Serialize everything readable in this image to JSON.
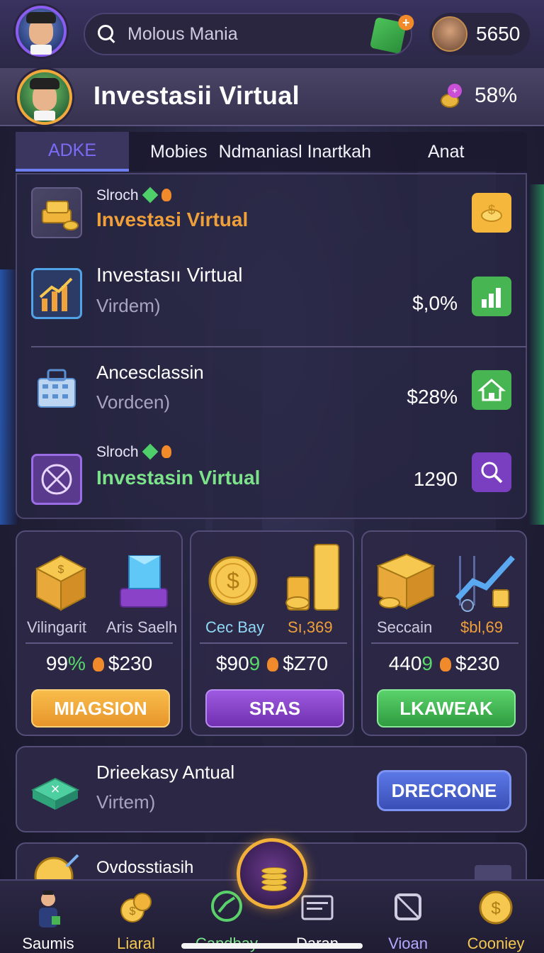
{
  "topbar": {
    "search_text": "Molous Mania",
    "coins": "5650"
  },
  "header": {
    "title": "Investasii Virtual",
    "percent": "58%"
  },
  "tabs": [
    "ADKE",
    "Mobies",
    "Ndmaniasl Inartkah",
    "Anat"
  ],
  "list": [
    {
      "top": "Slroch",
      "title": "Investasi Virtual",
      "sub": "",
      "value": "",
      "accent": "#f0a03a"
    },
    {
      "top": "",
      "title": "Investasıı Virtual",
      "sub": "Virdem)",
      "value": "$,0%",
      "accent": "#46b552"
    },
    {
      "top": "",
      "title": "Ancesclassin",
      "sub": "Vordcen)",
      "value": "$28%",
      "accent": "#46b552"
    },
    {
      "top": "Slroch",
      "title": "Investasin Virtual",
      "sub": "",
      "value": "1290",
      "accent": "#7a3fc0"
    }
  ],
  "cards": [
    {
      "label_a": "Vilingarit",
      "label_b": "Aris Saelh",
      "stat_a": "99",
      "stat_a_green": "%",
      "stat_b": "$230",
      "button": "MIAGSION",
      "button_color": "#f0a33a"
    },
    {
      "label_a": "Cec Bay",
      "label_b": "Sı,369",
      "stat_a": "$90",
      "stat_a_green": "9",
      "stat_b": "$Z70",
      "button": "SRAS",
      "button_color": "#8a42c8"
    },
    {
      "label_a": "Seccain",
      "label_b": "$bl,69",
      "stat_a": "440",
      "stat_a_green": "9",
      "stat_b": "$230",
      "button": "LKAWEAK",
      "button_color": "#3fb84e"
    }
  ],
  "wide_card": {
    "title": "Drieekasy Antual",
    "sub": "Virtem)",
    "button": "DRECRONE"
  },
  "peek_card": {
    "title": "Ovdosstiasih"
  },
  "nav": [
    "Saumis",
    "Liaral",
    "Candbay",
    "Daran",
    "Vioan",
    "Cooniey"
  ]
}
